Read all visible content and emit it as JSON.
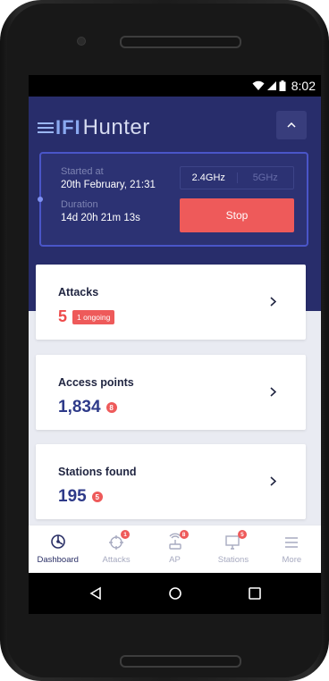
{
  "status_bar": {
    "time": "8:02"
  },
  "app": {
    "logo_fi": "IFI",
    "logo_hunter": "Hunter"
  },
  "session": {
    "started_label": "Started at",
    "started_value": "20th February, 21:31",
    "duration_label": "Duration",
    "duration_value": "14d 20h 21m 13s",
    "freq_options": [
      "2.4GHz",
      "5GHz"
    ],
    "freq_selected": "2.4GHz",
    "stop_label": "Stop"
  },
  "cards": {
    "attacks": {
      "title": "Attacks",
      "value": "5",
      "badge": "1 ongoing"
    },
    "access_points": {
      "title": "Access points",
      "value": "1,834",
      "badge": "8"
    },
    "stations": {
      "title": "Stations found",
      "value": "195",
      "badge": "5"
    }
  },
  "bottom_nav": {
    "items": [
      {
        "label": "Dashboard",
        "icon": "dashboard-icon",
        "active": true
      },
      {
        "label": "Attacks",
        "icon": "crosshair-icon",
        "badge": "1"
      },
      {
        "label": "AP",
        "icon": "router-icon",
        "badge": "8"
      },
      {
        "label": "Stations",
        "icon": "monitor-icon",
        "badge": "5"
      },
      {
        "label": "More",
        "icon": "menu-icon"
      }
    ]
  },
  "colors": {
    "header_bg": "#282d6b",
    "accent_red": "#ee5a5a",
    "accent_blue": "#4a55c8",
    "value_blue": "#2e3a89"
  }
}
